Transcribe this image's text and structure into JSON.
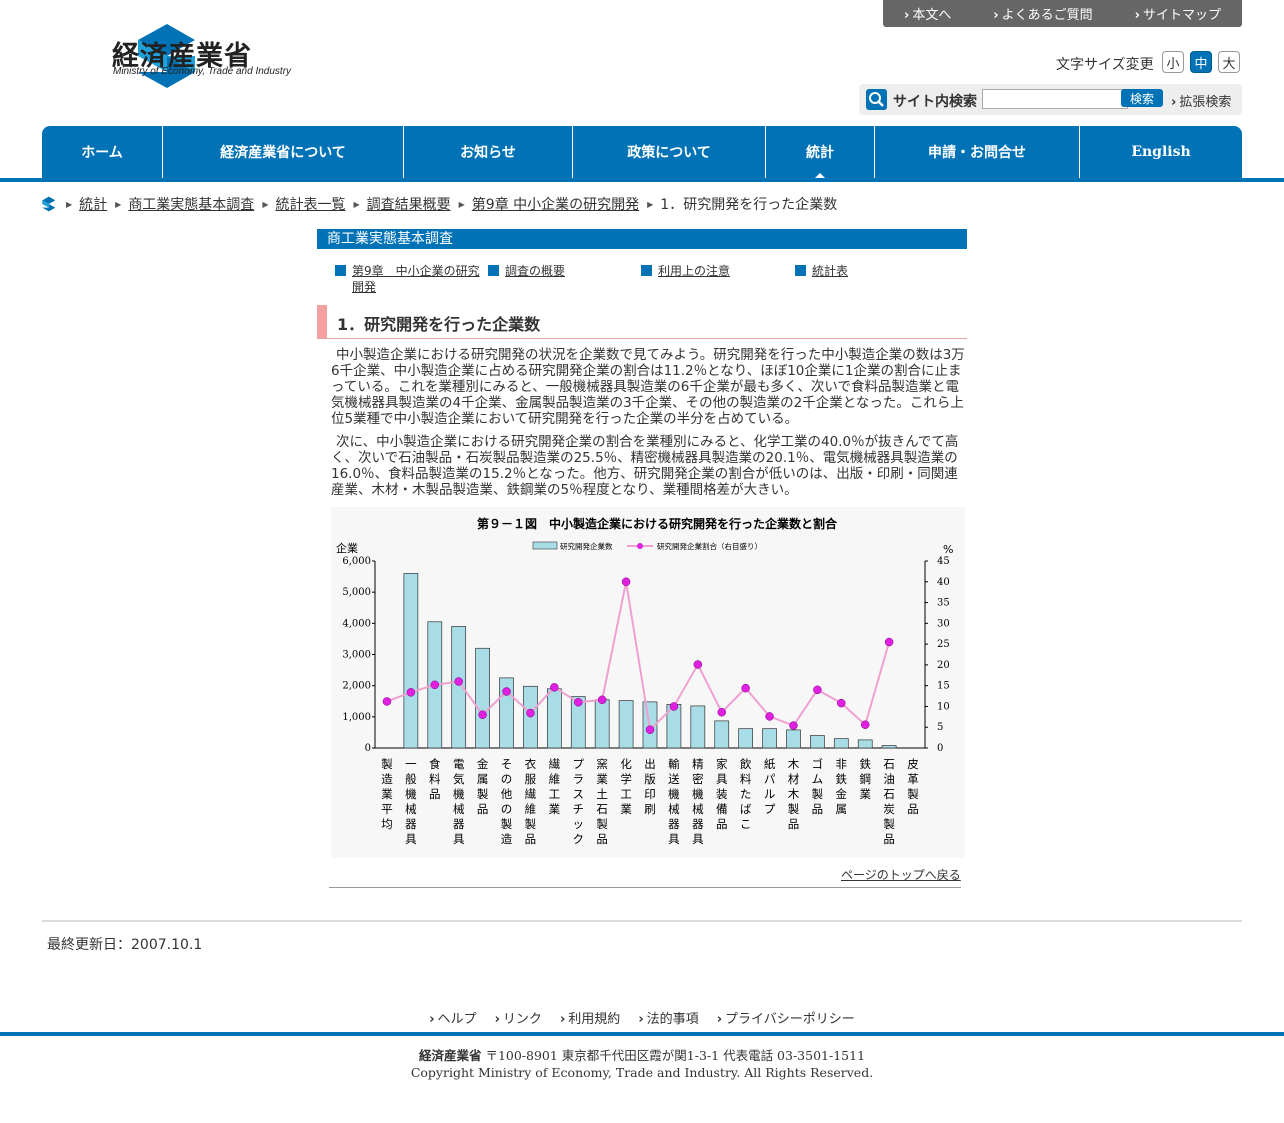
{
  "top_links": [
    "本文へ",
    "よくあるご質問",
    "サイトマップ"
  ],
  "logo": {
    "title": "経済産業省",
    "subtitle": "Ministry of Economy, Trade and Industry"
  },
  "font_size": {
    "label": "文字サイズ変更",
    "options": [
      "小",
      "中",
      "大"
    ],
    "selected": "中"
  },
  "search": {
    "label": "サイト内検索",
    "value": "",
    "button": "検索",
    "advanced": "拡張検索"
  },
  "nav": [
    "ホーム",
    "経済産業省について",
    "お知らせ",
    "政策について",
    "統計",
    "申請・お問合せ",
    "English"
  ],
  "nav_active": "統計",
  "breadcrumb": [
    "統計",
    "商工業実態基本調査",
    "統計表一覧",
    "調査結果概要",
    "第9章 中小企業の研究開発",
    "1．研究開発を行った企業数"
  ],
  "section_title": "商工業実態基本調査",
  "sub_links": [
    "第9章　中小企業の研究開発",
    "調査の概要",
    "利用上の注意",
    "統計表"
  ],
  "heading": "1．研究開発を行った企業数",
  "paragraphs": [
    "中小製造企業における研究開発の状況を企業数で見てみよう。研究開発を行った中小製造企業の数は3万6千企業、中小製造企業に占める研究開発企業の割合は11.2％となり、ほぼ10企業に1企業の割合に止まっている。これを業種別にみると、一般機械器具製造業の6千企業が最も多く、次いで食料品製造業と電気機械器具製造業の4千企業、金属製品製造業の3千企業、その他の製造業の2千企業となった。これら上位5業種で中小製造企業において研究開発を行った企業の半分を占めている。",
    "次に、中小製造企業における研究開発企業の割合を業種別にみると、化学工業の40.0％が抜きんでて高く、次いで石油製品・石炭製品製造業の25.5％、精密機械器具製造業の20.1％、電気機械器具製造業の16.0％、食料品製造業の15.2％となった。他方、研究開発企業の割合が低いのは、出版・印刷・同関連産業、木材・木製品製造業、鉄鋼業の5％程度となり、業種間格差が大きい。"
  ],
  "chart_data": {
    "type": "bar",
    "title": "第９－１図　中小製造企業における研究開発を行った企業数と割合",
    "ylabel": "企業",
    "y2label": "%",
    "ylim": [
      0,
      6000
    ],
    "y2lim": [
      0,
      45
    ],
    "yticks": [
      "0",
      "1,000",
      "2,000",
      "3,000",
      "4,000",
      "5,000",
      "6,000"
    ],
    "y2ticks": [
      "0",
      "5",
      "10",
      "15",
      "20",
      "25",
      "30",
      "35",
      "40",
      "45"
    ],
    "legend": [
      "研究開発企業数",
      "研究開発企業割合（右目盛り）"
    ],
    "categories": [
      "製造業平均",
      "一般機械器具",
      "食料品",
      "電気機械器具",
      "金属製品",
      "その他の製造",
      "衣服繊維製品",
      "繊維工業",
      "プラスチック",
      "窯業土石製品",
      "化学工業",
      "出版印刷",
      "輸送機械器具",
      "精密機械器具",
      "家具装備品",
      "飲料たばこ",
      "紙パルプ",
      "木材木製品",
      "ゴム製品",
      "非鉄金属",
      "鉄鋼業",
      "石油石炭製品",
      "皮革製品"
    ],
    "series": [
      {
        "name": "研究開発企業数",
        "kind": "bar",
        "values": [
          null,
          5600,
          4050,
          3900,
          3200,
          2250,
          1980,
          1900,
          1650,
          1550,
          1520,
          1480,
          1400,
          1350,
          870,
          620,
          620,
          580,
          400,
          300,
          260,
          80,
          0
        ]
      },
      {
        "name": "研究開発企業割合（右目盛り）",
        "kind": "line",
        "values": [
          11.2,
          13.4,
          15.2,
          16.0,
          8.0,
          13.6,
          8.4,
          14.6,
          11.0,
          11.6,
          40.0,
          4.4,
          10.0,
          20.1,
          8.6,
          14.4,
          7.6,
          5.4,
          14.0,
          10.8,
          5.6,
          25.5,
          null
        ]
      }
    ],
    "colors": {
      "bar": "#a8dde8",
      "line": "#f0a0d0",
      "marker": "#e020e0"
    }
  },
  "page_top": "ページのトップへ戻る",
  "last_updated": "最終更新日：2007.10.1",
  "footer_links": [
    "ヘルプ",
    "リンク",
    "利用規約",
    "法的事項",
    "プライバシーポリシー"
  ],
  "footer": {
    "org": "経済産業省",
    "address": "〒100-8901 東京都千代田区霞が関1-3-1 代表電話 03-3501-1511",
    "copyright": "Copyright Ministry of Economy, Trade and Industry. All Rights Reserved."
  },
  "colors": {
    "brand": "#0072b5",
    "heading_accent": "#f4a0a0"
  }
}
